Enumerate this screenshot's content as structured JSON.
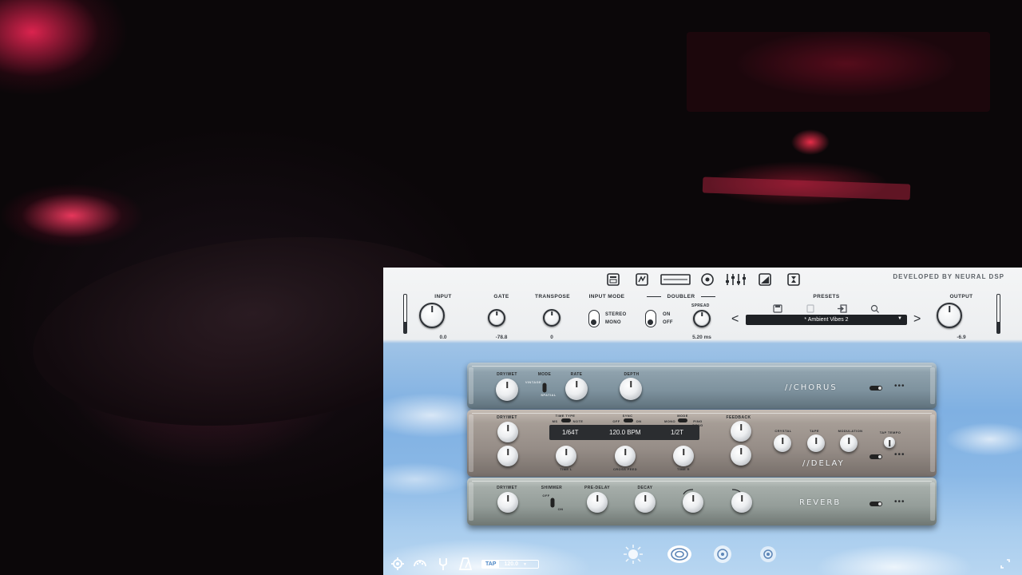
{
  "window": {
    "developer_label": "DEVELOPED BY NEURAL DSP"
  },
  "header": {
    "input": {
      "label": "INPUT",
      "value": "0.0"
    },
    "gate": {
      "label": "GATE",
      "value": "-78.8"
    },
    "transpose": {
      "label": "TRANSPOSE",
      "value": "0"
    },
    "input_mode": {
      "label": "INPUT MODE",
      "options": [
        "STEREO",
        "MONO"
      ],
      "selected": "MONO"
    },
    "doubler": {
      "label": "DOUBLER",
      "options": [
        "ON",
        "OFF"
      ],
      "selected": "OFF",
      "spread_label": "SPREAD",
      "spread_value": "5.20 ms"
    },
    "presets": {
      "label": "PRESETS",
      "current": "* Ambient Vibes 2"
    },
    "output": {
      "label": "OUTPUT",
      "value": "-6.9"
    }
  },
  "top_icons": [
    "amp-icon",
    "pedal-icon",
    "rack-icon",
    "cab-icon",
    "eq-icon",
    "ramp-icon",
    "hourglass-icon"
  ],
  "chorus": {
    "title": "//CHORUS",
    "labels": {
      "drywet": "DRY/WET",
      "mode": "MODE",
      "rate": "RATE",
      "depth": "DEPTH",
      "mode_a": "VINTAGE",
      "mode_b": "SPATIAL"
    }
  },
  "delay": {
    "title": "//DELAY",
    "labels": {
      "drywet": "DRY/WET",
      "time_type": "TIME TYPE",
      "sync": "SYNC",
      "mode": "MODE",
      "feedback": "FEEDBACK",
      "crystal": "CRYSTAL",
      "tape": "TAPE",
      "modulation": "MODULATION",
      "tap_tempo": "TAP TEMPO",
      "time_l": "TIME L",
      "cross_feed": "CROSS FEED",
      "time_r": "TIME R",
      "sync_off": "OFF",
      "sync_on": "ON",
      "mode_mono": "MONO",
      "mode_pingpong": "PING PONG",
      "tt_ms": "MS",
      "tt_note": "NOTE"
    },
    "display": {
      "left": "1/64T",
      "center": "120.0 BPM",
      "right": "1/2T"
    }
  },
  "reverb": {
    "title": "REVERB",
    "labels": {
      "drywet": "DRY/WET",
      "shimmer": "SHIMMER",
      "predelay": "PRE-DELAY",
      "decay": "DECAY",
      "shimmer_off": "OFF",
      "shimmer_on": "ON"
    }
  },
  "toolbar": {
    "tap_label": "TAP",
    "bpm": "120.0"
  },
  "colors": {
    "accent_dark": "#2b2f34",
    "sky": "#7fb0e2",
    "display_bg": "#2b2d30"
  }
}
